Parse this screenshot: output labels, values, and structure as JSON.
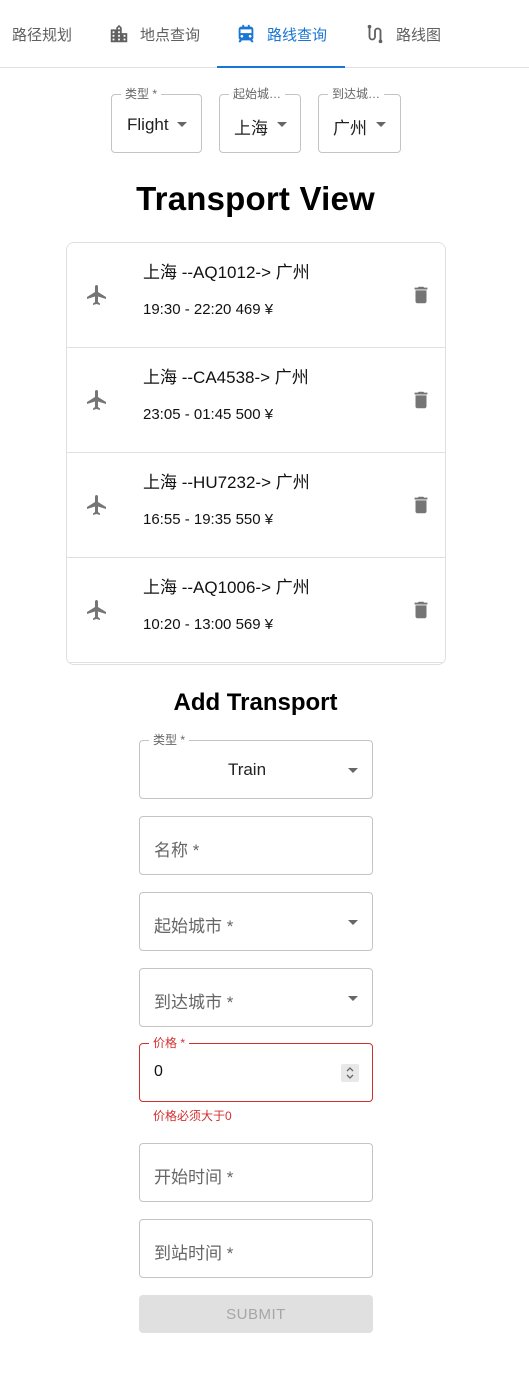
{
  "tabs": [
    {
      "label": "路径规划",
      "icon": ""
    },
    {
      "label": "地点查询",
      "icon": "building-icon"
    },
    {
      "label": "路线查询",
      "icon": "transport-icon"
    },
    {
      "label": "路线图",
      "icon": "route-icon"
    }
  ],
  "filters": {
    "type": {
      "label": "类型 *",
      "value": "Flight"
    },
    "from": {
      "label": "起始城…",
      "value": "上海"
    },
    "to": {
      "label": "到达城…",
      "value": "广州"
    }
  },
  "title": "Transport View",
  "list": [
    {
      "route": "上海 --AQ1012-> 广州",
      "time": "19:30 - 22:20 469 ¥",
      "icon": "airplane-icon"
    },
    {
      "route": "上海 --CA4538-> 广州",
      "time": "23:05 - 01:45 500 ¥",
      "icon": "airplane-icon"
    },
    {
      "route": "上海 --HU7232-> 广州",
      "time": "16:55 - 19:35 550 ¥",
      "icon": "airplane-icon"
    },
    {
      "route": "上海 --AQ1006-> 广州",
      "time": "10:20 - 13:00 569 ¥",
      "icon": "airplane-icon"
    }
  ],
  "form": {
    "title": "Add Transport",
    "type": {
      "label": "类型 *",
      "value": "Train"
    },
    "name": {
      "placeholder": "名称 *"
    },
    "from": {
      "placeholder": "起始城市 *"
    },
    "to": {
      "placeholder": "到达城市 *"
    },
    "price": {
      "label": "价格 *",
      "value": "0",
      "error": "价格必须大于0"
    },
    "start": {
      "placeholder": "开始时间 *"
    },
    "end": {
      "placeholder": "到站时间 *"
    },
    "submit": "SUBMIT"
  },
  "colors": {
    "accent": "#1976d2",
    "error": "#d32f2f",
    "icon": "#757575"
  }
}
